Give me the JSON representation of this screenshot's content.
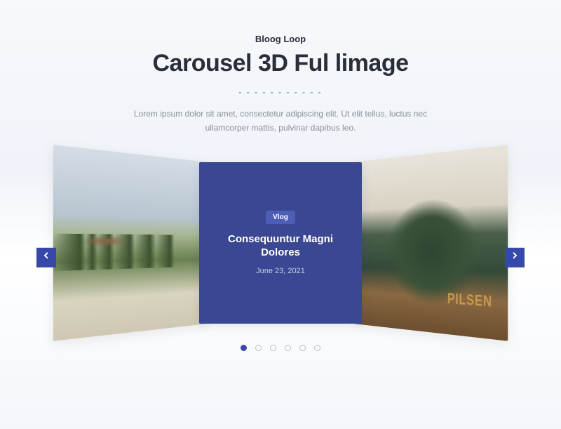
{
  "header": {
    "subtitle": "Bloog Loop",
    "title": "Carousel 3D Ful limage",
    "description": "Lorem ipsum dolor sit amet, consectetur adipiscing elit. Ut elit tellus, luctus nec ullamcorper mattis, pulvinar dapibus leo."
  },
  "carousel": {
    "center": {
      "tag": "Vlog",
      "title": "Consequuntur Magni Dolores",
      "date": "June 23, 2021"
    },
    "totalDots": 6,
    "activeDot": 0
  },
  "colors": {
    "accent": "#3648a8",
    "cardBg": "#3a4792"
  }
}
